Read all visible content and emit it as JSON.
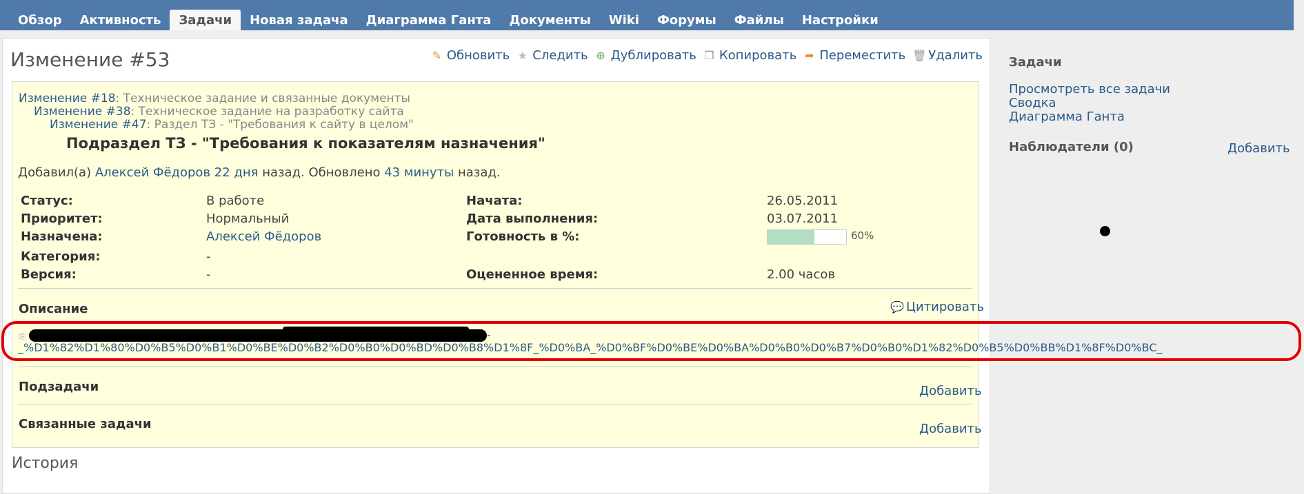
{
  "nav": {
    "tabs": [
      {
        "label": "Обзор",
        "selected": false
      },
      {
        "label": "Активность",
        "selected": false
      },
      {
        "label": "Задачи",
        "selected": true
      },
      {
        "label": "Новая задача",
        "selected": false
      },
      {
        "label": "Диаграмма Ганта",
        "selected": false
      },
      {
        "label": "Документы",
        "selected": false
      },
      {
        "label": "Wiki",
        "selected": false
      },
      {
        "label": "Форумы",
        "selected": false
      },
      {
        "label": "Файлы",
        "selected": false
      },
      {
        "label": "Настройки",
        "selected": false
      }
    ]
  },
  "issue": {
    "title": "Изменение #53",
    "actions": {
      "update": "Обновить",
      "watch": "Следить",
      "duplicate": "Дублировать",
      "copy": "Копировать",
      "move": "Переместить",
      "delete": "Удалить"
    },
    "parents": [
      {
        "link": "Изменение #18",
        "text": ": Техническое задание и связанные документы"
      },
      {
        "link": "Изменение #38",
        "text": ": Техническое задание на разработку сайта"
      },
      {
        "link": "Изменение #47",
        "text": ": Раздел ТЗ - \"Требования к сайту в целом\""
      }
    ],
    "subject": "Подраздел ТЗ - \"Требования к показателям назначения\"",
    "author": {
      "prefix": "Добавил(а) ",
      "name": "Алексей Фёдоров",
      "added": "22 дня",
      "mid": " назад. Обновлено ",
      "updated": "43 минуты",
      "suffix": " назад."
    },
    "attributes": {
      "status_label": "Статус:",
      "status": "В работе",
      "priority_label": "Приоритет:",
      "priority": "Нормальный",
      "assignee_label": "Назначена:",
      "assignee": "Алексей Фёдоров",
      "category_label": "Категория:",
      "category": "-",
      "version_label": "Версия:",
      "version": "-",
      "start_label": "Начата:",
      "start": "26.05.2011",
      "due_label": "Дата выполнения:",
      "due": "03.07.2011",
      "done_label": "Готовность в %:",
      "done_text": "60%",
      "done_value": 60,
      "estimate_label": "Оцененное время:",
      "estimate": "2.00 часов"
    },
    "description": {
      "title": "Описание",
      "quote": "Цитировать",
      "wiki_dash": "-",
      "wiki_link": "_%D1%82%D1%80%D0%B5%D0%B1%D0%BE%D0%B2%D0%B0%D0%BD%D0%B8%D1%8F_%D0%BA_%D0%BF%D0%BE%D0%BA%D0%B0%D0%B7%D0%B0%D1%82%D0%B5%D0%BB%D1%8F%D0%BC_"
    },
    "subtasks": {
      "title": "Подзадачи",
      "add": "Добавить"
    },
    "relations": {
      "title": "Связанные задачи",
      "add": "Добавить"
    },
    "history": "История"
  },
  "sidebar": {
    "issues_title": "Задачи",
    "links": [
      "Просмотреть все задачи",
      "Сводка",
      "Диаграмма Ганта"
    ],
    "watchers_title": "Наблюдатели (0)",
    "watchers_add": "Добавить"
  }
}
